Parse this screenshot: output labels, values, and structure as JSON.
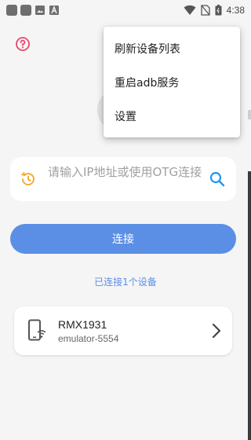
{
  "status_bar": {
    "time": "4:38",
    "icons": [
      "notification-icon",
      "notification-icon",
      "image-icon",
      "font-icon",
      "wifi-icon",
      "no-sim-icon",
      "battery-icon"
    ]
  },
  "colors": {
    "accent": "#5b8fe6",
    "help": "#e8466e",
    "history": "#f5a623",
    "search": "#2196f3"
  },
  "input": {
    "placeholder": "请输入IP地址或使用OTG连接",
    "value": ""
  },
  "connect_button": {
    "label": "连接"
  },
  "connected_status": "已连接1个设备",
  "devices": [
    {
      "name": "RMX1931",
      "serial": "emulator-5554"
    }
  ],
  "menu": {
    "items": [
      {
        "label": "刷新设备列表"
      },
      {
        "label": "重启adb服务"
      },
      {
        "label": "设置"
      }
    ]
  }
}
